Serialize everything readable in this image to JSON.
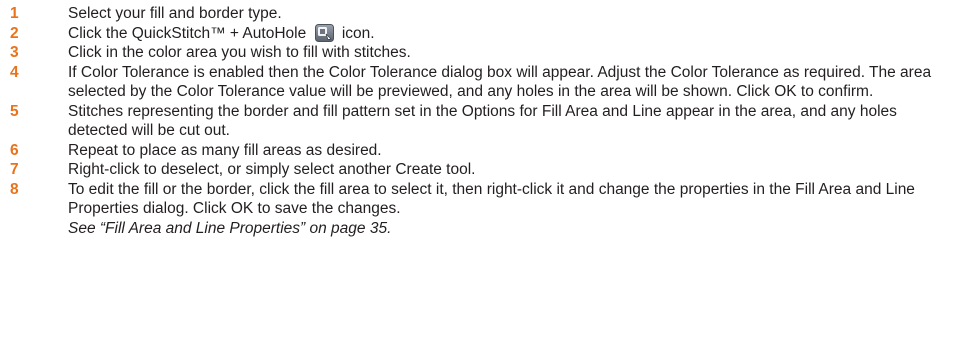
{
  "accent_color": "#e8731c",
  "steps": [
    {
      "number": "1",
      "text": "Select your fill and border type."
    },
    {
      "number": "2",
      "text_before": "Click the QuickStitch™ + AutoHole",
      "icon": "quickstitch-autohole-icon",
      "text_after": "icon."
    },
    {
      "number": "3",
      "text": "Click in the color area you wish to fill with stitches."
    },
    {
      "number": "4",
      "text": "If Color Tolerance is enabled then the Color Tolerance dialog box will appear. Adjust the Color Tolerance as required. The area selected by the Color Tolerance value will be previewed, and any holes in the area will be shown. Click OK to confirm."
    },
    {
      "number": "5",
      "text": "Stitches representing the border and fill pattern set in the Options for Fill Area and Line appear in the area, and any holes detected will be cut out."
    },
    {
      "number": "6",
      "text": "Repeat to place as many fill areas as desired."
    },
    {
      "number": "7",
      "text": "Right-click to deselect, or simply select another Create tool."
    },
    {
      "number": "8",
      "text": "To edit the fill or the border, click the fill area to select it, then right-click it and change the properties in the Fill Area and Line Properties dialog. Click OK to save the changes.",
      "note": "See “Fill Area and Line Properties” on page 35."
    }
  ]
}
